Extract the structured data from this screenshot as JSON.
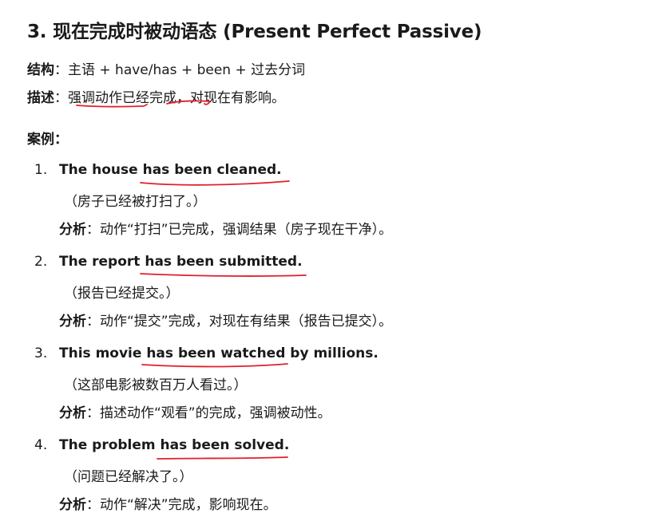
{
  "heading": "3. 现在完成时被动语态 (Present Perfect Passive)",
  "structure": {
    "label": "结构",
    "sep": "：",
    "text": "主语 + have/has + been + 过去分词"
  },
  "description": {
    "label": "描述",
    "sep": "：",
    "text_a": "强调动作已经完成，",
    "text_b": "对现在有影响。"
  },
  "examples_label": "案例：",
  "examples": [
    {
      "num": "1.",
      "pre": "The house ",
      "hl": "has been cleaned.",
      "post": "",
      "zh": "（房子已经被打扫了。）",
      "analysis_label": "分析",
      "analysis_sep": "：",
      "analysis": "动作“打扫”已完成，强调结果（房子现在干净）。"
    },
    {
      "num": "2.",
      "pre": "The report ",
      "hl": "has been submitted.",
      "post": "",
      "zh": "（报告已经提交。）",
      "analysis_label": "分析",
      "analysis_sep": "：",
      "analysis": "动作“提交”完成，对现在有结果（报告已提交）。"
    },
    {
      "num": "3.",
      "pre": "This movie ",
      "hl": "has been watched",
      "post": " by millions.",
      "zh": "（这部电影被数百万人看过。）",
      "analysis_label": "分析",
      "analysis_sep": "：",
      "analysis": "描述动作“观看”的完成，强调被动性。"
    },
    {
      "num": "4.",
      "pre": "The problem ",
      "hl": "has been solved.",
      "post": "",
      "zh": "（问题已经解决了。）",
      "analysis_label": "分析",
      "analysis_sep": "：",
      "analysis": "动作“解决”完成，影响现在。"
    }
  ],
  "annotation_color": "#e0202a"
}
